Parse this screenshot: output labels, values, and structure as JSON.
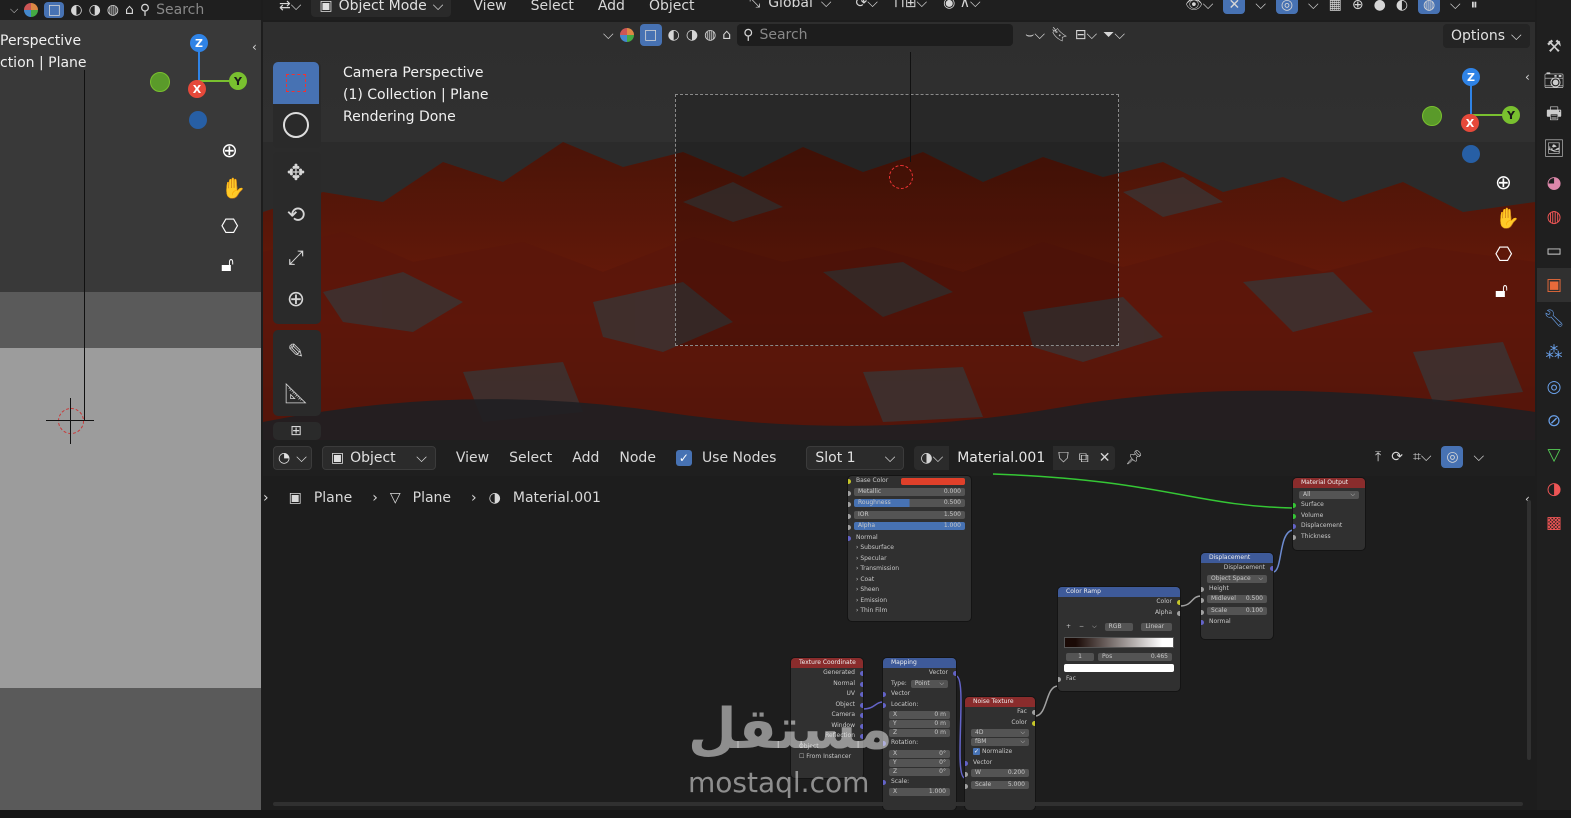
{
  "colors": {
    "accent": "#4772b3",
    "terrain": "#6b1a0a",
    "node_link": "#35c735",
    "color_socket": "#c7c729"
  },
  "top_header": {
    "mode": "Object Mode",
    "menus": [
      "View",
      "Select",
      "Add",
      "Object"
    ],
    "search_placeholder": "Search",
    "orientation": "Global"
  },
  "viewport_header": {
    "search_placeholder": "Search",
    "options_label": "Options"
  },
  "left_viewport": {
    "line1": "Perspective",
    "line2": "ction | Plane"
  },
  "main_viewport": {
    "line1": "Camera Perspective",
    "line2": "(1) Collection | Plane",
    "line3": "Rendering Done"
  },
  "gizmo": {
    "z": "Z",
    "x": "X",
    "y": "Y"
  },
  "node_header": {
    "editor_type": "Object",
    "menus": [
      "View",
      "Select",
      "Add",
      "Node"
    ],
    "use_nodes_label": "Use Nodes",
    "slot": "Slot 1",
    "material": "Material.001"
  },
  "breadcrumb": [
    "Plane",
    "Plane",
    "Material.001"
  ],
  "nodes": {
    "principled": {
      "base_color": "Base Color",
      "metallic": "Metallic",
      "metallic_val": "0.000",
      "roughness": "Roughness",
      "roughness_val": "0.500",
      "ior": "IOR",
      "ior_val": "1.500",
      "alpha": "Alpha",
      "alpha_val": "1.000",
      "normal": "Normal",
      "panels": [
        "Subsurface",
        "Specular",
        "Transmission",
        "Coat",
        "Sheen",
        "Emission",
        "Thin Film"
      ]
    },
    "material_output": {
      "title": "Material Output",
      "target": "All",
      "sockets": [
        "Surface",
        "Volume",
        "Displacement",
        "Thickness"
      ]
    },
    "displacement": {
      "title": "Displacement",
      "out": "Displacement",
      "space": "Object Space",
      "height": "Height",
      "midlevel": "Midlevel",
      "midlevel_val": "0.500",
      "scale": "Scale",
      "scale_val": "0.100",
      "normal": "Normal"
    },
    "color_ramp": {
      "title": "Color Ramp",
      "out_color": "Color",
      "out_alpha": "Alpha",
      "mode": "RGB",
      "interp": "Linear",
      "index": "1",
      "pos": "Pos",
      "pos_val": "0.465",
      "fac": "Fac"
    },
    "texture_coordinate": {
      "title": "Texture Coordinate",
      "outputs": [
        "Generated",
        "Normal",
        "UV",
        "Object",
        "Camera",
        "Window",
        "Reflection"
      ],
      "object_label": "Object",
      "from_instancer": "From Instancer"
    },
    "mapping": {
      "title": "Mapping",
      "out": "Vector",
      "type_label": "Type:",
      "type_val": "Point",
      "vector": "Vector",
      "location": "Location:",
      "loc": [
        "0 m",
        "0 m",
        "0 m"
      ],
      "rotation": "Rotation:",
      "rot": [
        "0°",
        "0°",
        "0°"
      ],
      "scale": "Scale:",
      "scale_x": "1.000",
      "axes": [
        "X",
        "Y",
        "Z"
      ]
    },
    "noise": {
      "title": "Noise Texture",
      "out_fac": "Fac",
      "out_color": "Color",
      "dim": "4D",
      "type": "fBM",
      "normalize": "Normalize",
      "vector": "Vector",
      "w": "W",
      "w_val": "0.200",
      "scale": "Scale",
      "scale_val": "5.000"
    }
  },
  "watermark": {
    "arabic": "مستقل",
    "latin": "mostaql.com"
  }
}
